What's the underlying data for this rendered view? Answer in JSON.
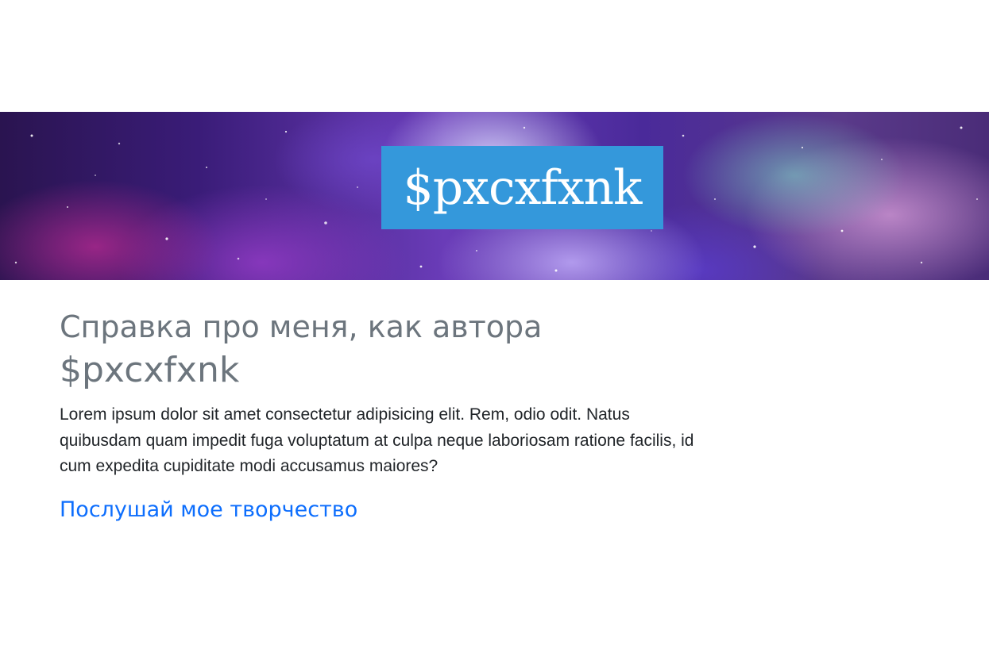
{
  "banner": {
    "logo_text": "$pxcxfxnk",
    "logo_bg_color": "#3498db"
  },
  "about": {
    "heading_line1": "Справка про меня, как автора",
    "heading_line2": "$pxcxfxnk",
    "paragraph": "Lorem ipsum dolor sit amet consectetur adipisicing elit. Rem, odio odit. Natus quibusdam quam impedit fuga voluptatum at culpa neque laboriosam ratione facilis, id cum expedita cupiditate modi accusamus maiores?",
    "listen_link": "Послушай мое творчество"
  },
  "colors": {
    "heading": "#6c757d",
    "text": "#212529",
    "link": "#0d6efd"
  }
}
